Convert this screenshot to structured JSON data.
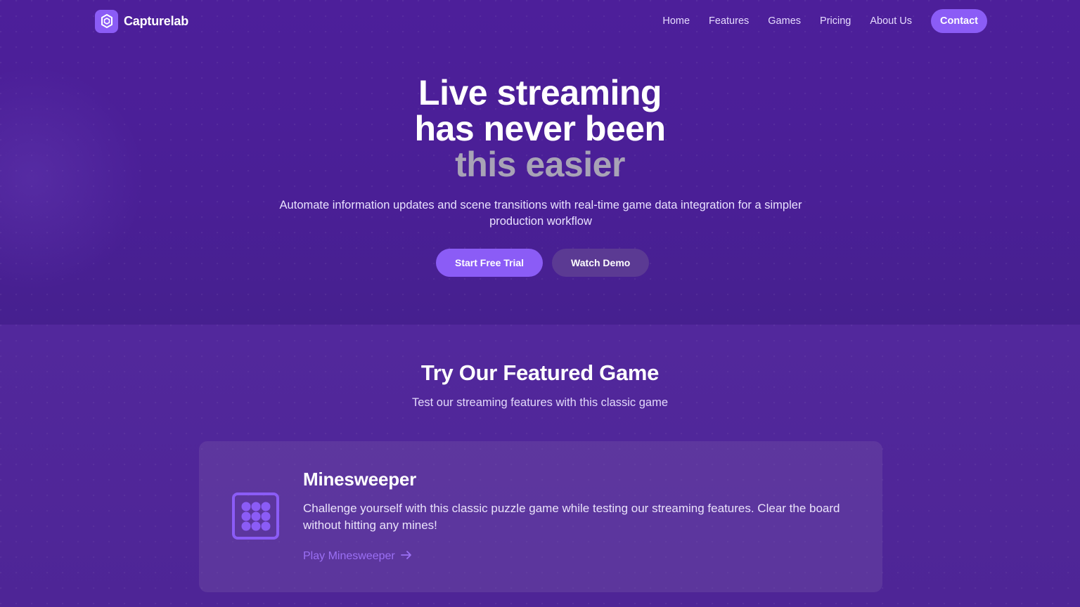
{
  "brand": {
    "name": "Capturelab",
    "icon": "hexagon-logo-icon",
    "accent": "#8b5cf6"
  },
  "nav": {
    "items": [
      {
        "label": "Home"
      },
      {
        "label": "Features"
      },
      {
        "label": "Games"
      },
      {
        "label": "Pricing"
      },
      {
        "label": "About Us"
      }
    ],
    "contact_label": "Contact"
  },
  "hero": {
    "title_line1": "Live streaming",
    "title_line2": "has never been",
    "title_line3": "this easier",
    "subtitle": "Automate information updates and scene transitions with real-time game data integration for a simpler production workflow",
    "primary_cta": "Start Free Trial",
    "secondary_cta": "Watch Demo"
  },
  "featured": {
    "title": "Try Our Featured Game",
    "subtitle": "Test our streaming features with this classic game",
    "game": {
      "icon": "grid-dots-icon",
      "name": "Minesweeper",
      "description": "Challenge yourself with this classic puzzle game while testing our streaming features. Clear the board without hitting any mines!",
      "link_label": "Play Minesweeper",
      "link_icon": "arrow-right-icon"
    }
  },
  "colors": {
    "background": "#4a1f96",
    "accent": "#8b5cf6",
    "muted_title": "#a8a3b6"
  }
}
